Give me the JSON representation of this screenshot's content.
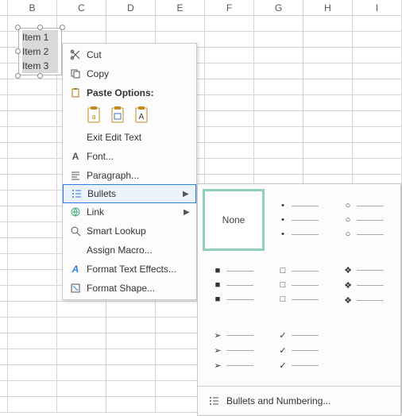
{
  "columns": [
    "B",
    "C",
    "D",
    "E",
    "F",
    "G",
    "H",
    "I"
  ],
  "textbox": {
    "items": [
      "Item 1",
      "Item 2",
      "Item 3"
    ]
  },
  "menu": {
    "cut": "Cut",
    "copy": "Copy",
    "paste_header": "Paste Options:",
    "exit_edit": "Exit Edit Text",
    "font": "Font...",
    "paragraph": "Paragraph...",
    "bullets": "Bullets",
    "link": "Link",
    "smart_lookup": "Smart Lookup",
    "assign_macro": "Assign Macro...",
    "format_text_effects": "Format Text Effects...",
    "format_shape": "Format Shape..."
  },
  "submenu": {
    "none": "None",
    "footer": "Bullets and Numbering...",
    "options": [
      {
        "id": "none",
        "label": "None",
        "selected": true
      },
      {
        "id": "disc",
        "symbol": "•"
      },
      {
        "id": "circle",
        "symbol": "○"
      },
      {
        "id": "square-filled",
        "symbol": "■"
      },
      {
        "id": "square-hollow",
        "symbol": "□"
      },
      {
        "id": "diamond",
        "symbol": "❖"
      },
      {
        "id": "arrow",
        "symbol": "➢"
      },
      {
        "id": "check",
        "symbol": "✓"
      },
      {
        "id": "blank",
        "symbol": ""
      }
    ]
  }
}
